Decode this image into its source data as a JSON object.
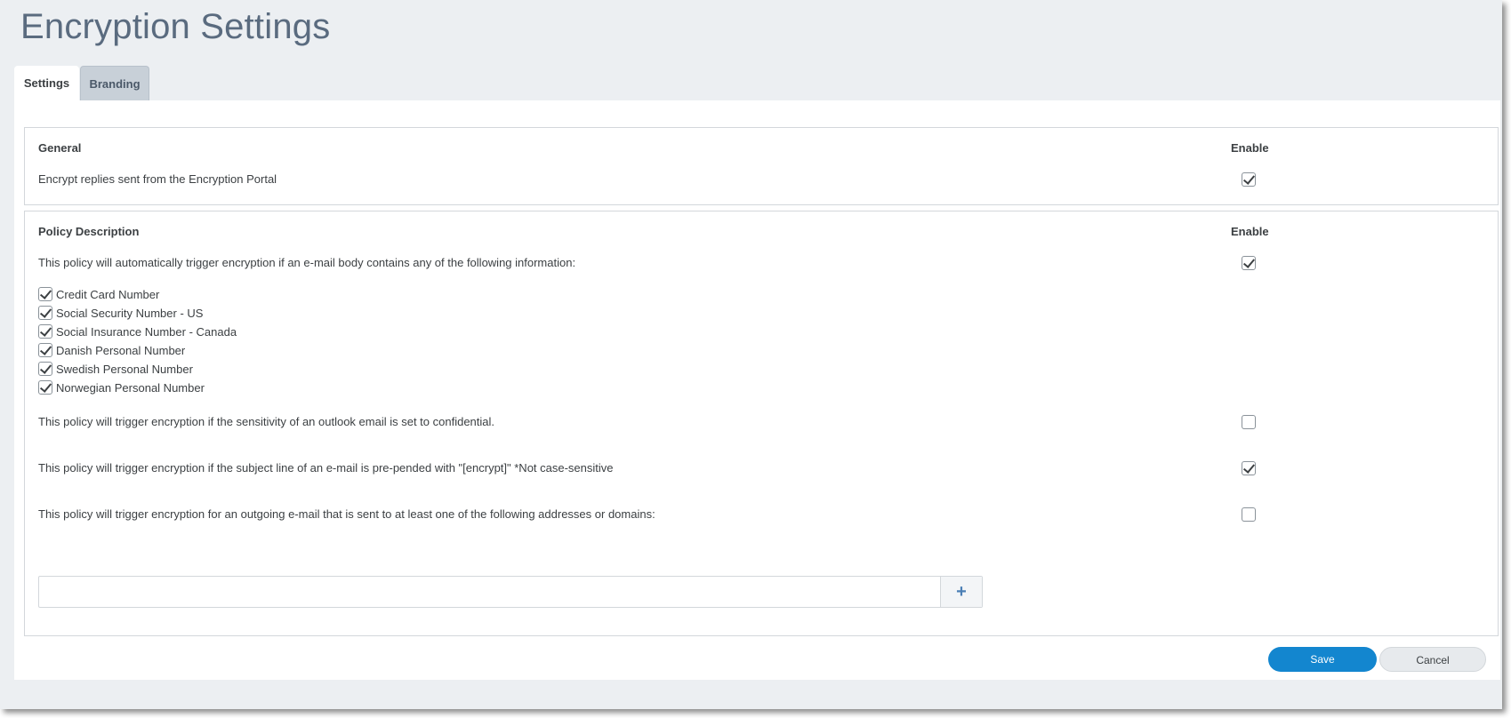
{
  "page": {
    "title": "Encryption Settings"
  },
  "tabs": [
    {
      "label": "Settings",
      "active": true
    },
    {
      "label": "Branding",
      "active": false
    }
  ],
  "general": {
    "heading": "General",
    "enable_label": "Enable",
    "rows": [
      {
        "text": "Encrypt replies sent from the Encryption Portal",
        "checked": true
      }
    ]
  },
  "policy": {
    "heading": "Policy Description",
    "enable_label": "Enable",
    "body_rule": {
      "text": "This policy will automatically trigger encryption if an e-mail body contains any of the following information:",
      "checked": true,
      "items": [
        {
          "label": "Credit Card Number",
          "checked": true
        },
        {
          "label": "Social Security Number - US",
          "checked": true
        },
        {
          "label": "Social Insurance Number - Canada",
          "checked": true
        },
        {
          "label": "Danish Personal Number",
          "checked": true
        },
        {
          "label": "Swedish Personal Number",
          "checked": true
        },
        {
          "label": "Norwegian Personal Number",
          "checked": true
        }
      ]
    },
    "sensitivity_rule": {
      "text": "This policy will trigger encryption if the sensitivity of an outlook email is set to confidential.",
      "checked": false
    },
    "subject_rule": {
      "text": "This policy will trigger encryption if the subject line of an e-mail is pre-pended with \"[encrypt]\" *Not case-sensitive",
      "checked": true
    },
    "address_rule": {
      "text": "This policy will trigger encryption for an outgoing e-mail that is sent to at least one of the following addresses or domains:",
      "checked": false
    },
    "address_input": {
      "value": "",
      "placeholder": "",
      "add_icon": "plus-icon",
      "add_glyph": "+"
    }
  },
  "actions": {
    "save_label": "Save",
    "cancel_label": "Cancel"
  },
  "colors": {
    "accent": "#1386cf",
    "title": "#5a6b7f",
    "background": "#eceff2"
  }
}
